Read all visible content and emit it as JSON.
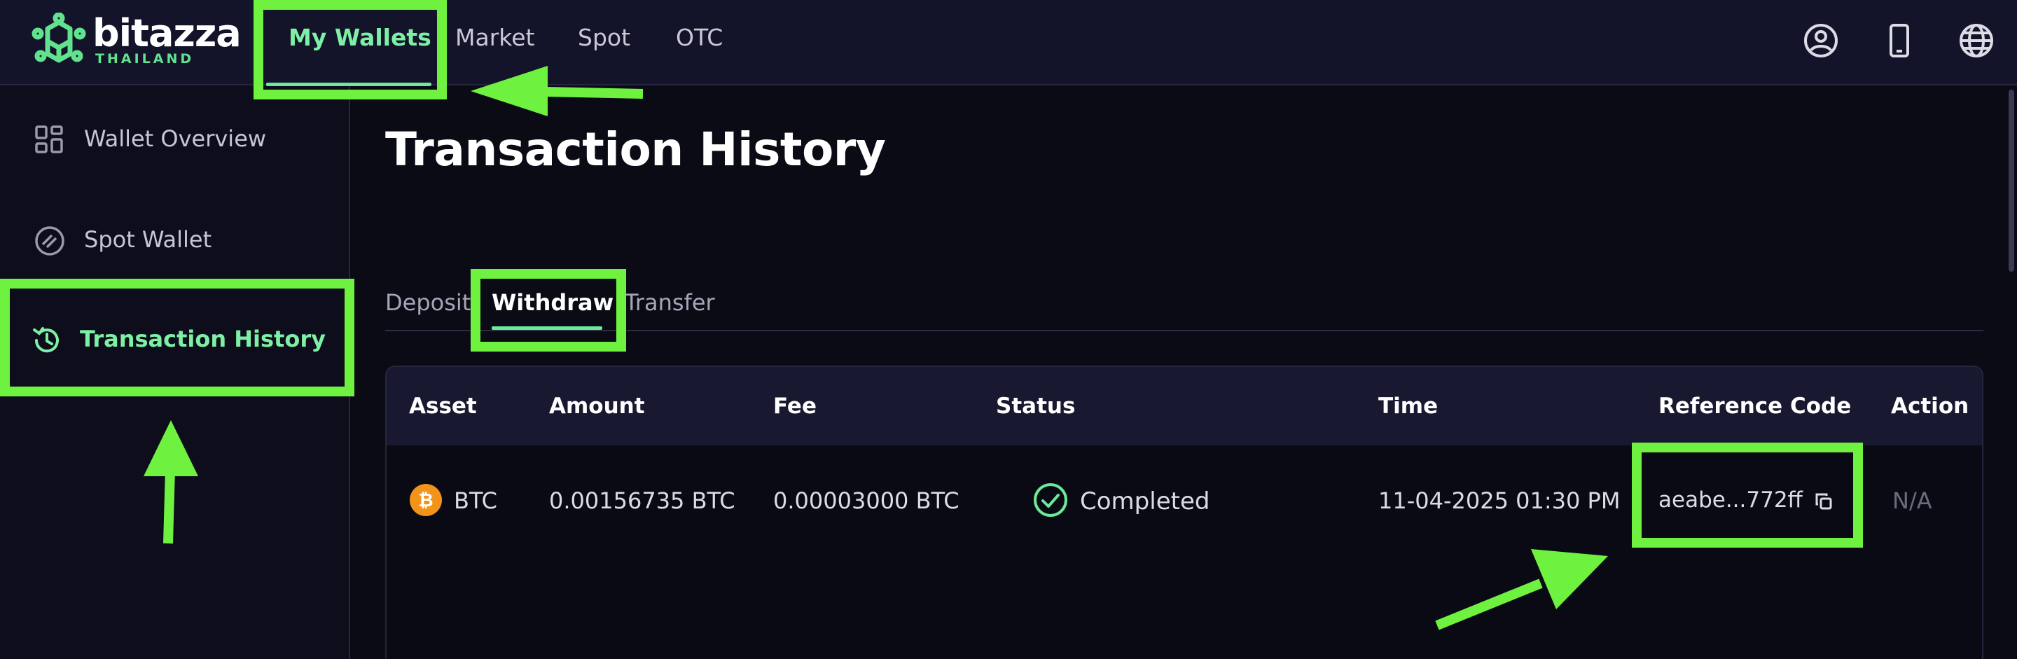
{
  "brand": {
    "name": "bitazza",
    "sub": "THAILAND",
    "accent_color": "#6bea9a",
    "annotation_color": "#6ef23f"
  },
  "header": {
    "nav": [
      {
        "label": "My Wallets",
        "active": true
      },
      {
        "label": "Market"
      },
      {
        "label": "Spot"
      },
      {
        "label": "OTC"
      }
    ],
    "icons": [
      "user-circle-icon",
      "mobile-phone-icon",
      "globe-icon"
    ]
  },
  "sidebar": {
    "items": [
      {
        "label": "Wallet Overview",
        "icon": "grid-icon"
      },
      {
        "label": "Spot Wallet",
        "icon": "spot-wallet-icon"
      },
      {
        "label": "Transaction History",
        "icon": "history-icon",
        "active": true
      }
    ]
  },
  "main": {
    "title": "Transaction History",
    "tabs": [
      {
        "label": "Deposit"
      },
      {
        "label": "Withdraw",
        "active": true
      },
      {
        "label": "Transfer"
      }
    ],
    "table": {
      "columns": [
        "Asset",
        "Amount",
        "Fee",
        "Status",
        "Time",
        "Reference Code",
        "Action"
      ],
      "rows": [
        {
          "asset": "BTC",
          "asset_icon": "bitcoin-icon",
          "amount": "0.00156735 BTC",
          "fee": "0.00003000 BTC",
          "status": "Completed",
          "status_icon": "check-circle-icon",
          "time": "11-04-2025 01:30 PM",
          "reference_code": "aeabe...772ff",
          "action": "N/A"
        }
      ]
    }
  }
}
